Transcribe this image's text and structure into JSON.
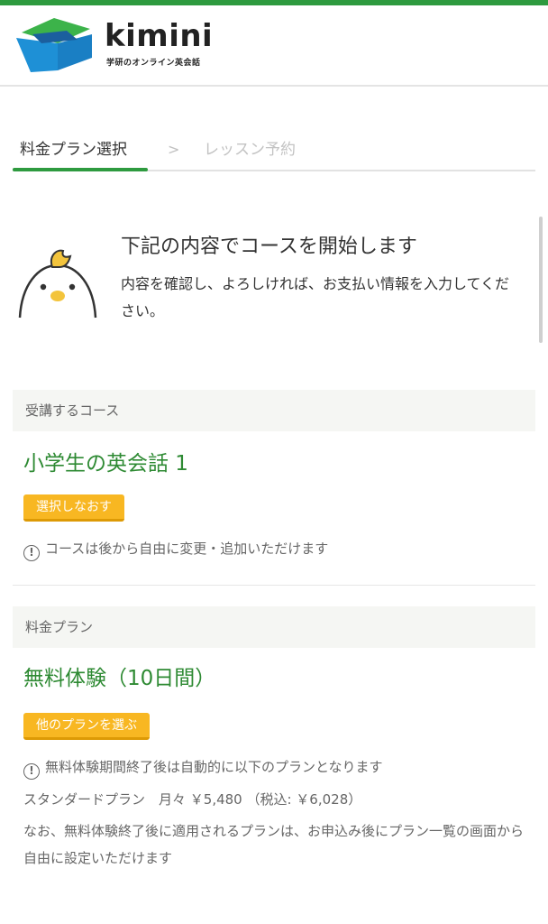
{
  "colors": {
    "brand_green": "#2e9a3f",
    "accent_yellow": "#f8b722",
    "section_bg": "#f5f6f3"
  },
  "logo": {
    "word": "kimini",
    "tagline": "学研のオンライン英会話"
  },
  "steps": {
    "step1": "料金プラン選択",
    "separator": ">",
    "step2": "レッスン予約"
  },
  "intro": {
    "title": "下記の内容でコースを開始します",
    "body": "内容を確認し、よろしければ、お支払い情報を入力してください。"
  },
  "course": {
    "label": "受講するコース",
    "name": "小学生の英会話 1",
    "button": "選択しなおす",
    "note": "コースは後から自由に変更・追加いただけます"
  },
  "plan": {
    "label": "料金プラン",
    "name": "無料体験（10日間）",
    "button": "他のプランを選ぶ",
    "note": "無料体験期間終了後は自動的に以下のプランとなります",
    "price": "スタンダードプラン　月々 ￥5,480 （税込: ￥6,028）",
    "detail": "なお、無料体験終了後に適用されるプランは、お申込み後にプラン一覧の画面から自由に設定いただけます"
  }
}
